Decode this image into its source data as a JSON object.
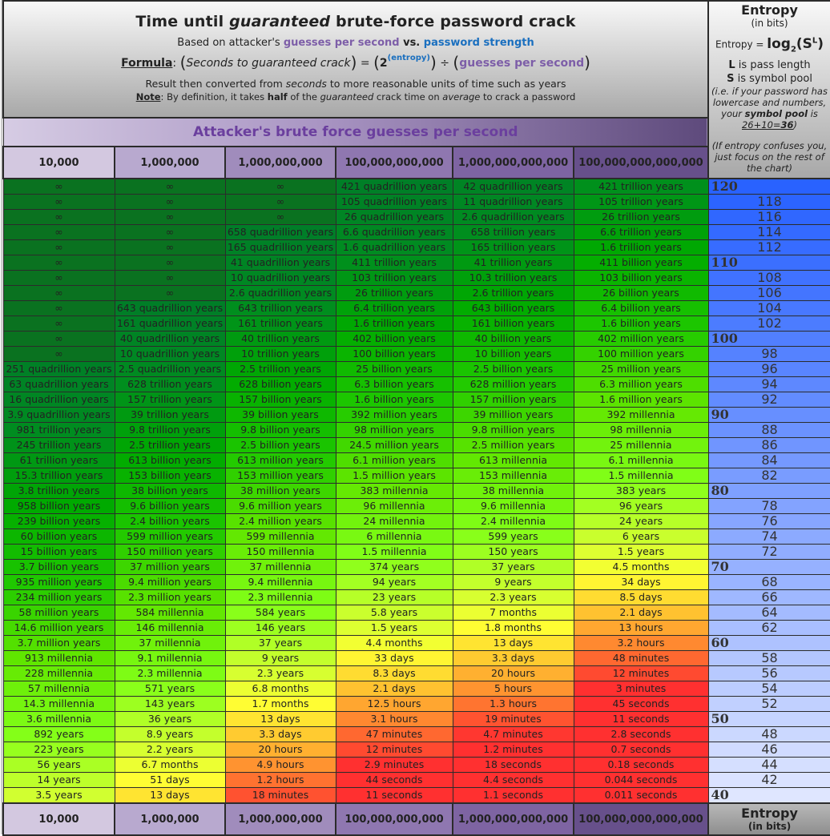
{
  "header": {
    "title_pre": "Time until ",
    "title_em": "guaranteed",
    "title_post": " brute-force password crack",
    "subtitle_pre": "Based on attacker's ",
    "subtitle_gps": "guesses per second",
    "subtitle_vs": " vs. ",
    "subtitle_strength": "password strength",
    "formula_label": "Formula",
    "formula_left": "Seconds to guaranteed crack",
    "formula_eq": "=",
    "formula_base": "2",
    "formula_exp": "(entropy)",
    "formula_div": "÷",
    "formula_right": "guesses per second",
    "result_pre": "Result then converted from ",
    "result_em": "seconds",
    "result_post": " to more reasonable units of time such as years",
    "note_label": "Note",
    "note_a": ": By definition, it takes ",
    "note_half": "half",
    "note_b": " of the ",
    "note_em": "guaranteed",
    "note_c": " crack time on ",
    "note_avg": "average",
    "note_d": " to crack a password"
  },
  "entropy_panel": {
    "title": "Entropy",
    "unit": "(in bits)",
    "formula_pre": "Entropy = ",
    "formula_log": "log",
    "formula_sub": "2",
    "formula_s": "(S",
    "formula_sup": "L",
    "formula_close": ")",
    "l_key": "L",
    "l_desc": " is pass length",
    "s_key": "S",
    "s_desc": " is symbol pool",
    "note_1": "(i.e. if your password has lowercase and numbers, your ",
    "note_symbol": "symbol pool",
    "note_is": " is ",
    "note_sum": "26+10=",
    "note_36": "36",
    "note_close": ")",
    "note_2": "(If entropy confuses you, just focus on the rest of the chart)"
  },
  "banner": {
    "pre": "Attacker's brute force ",
    "bold": "guesses per second"
  },
  "footer": {
    "entropy_title": "Entropy",
    "entropy_unit": "(in bits)"
  },
  "colors": {
    "entropy_blue_strong": "#2962ff",
    "entropy_blue_light": "#dfe6ff",
    "infinity_green": "#0a7220",
    "red": "#ff3030",
    "yellow": "#ffff33"
  },
  "chart_data": {
    "type": "table",
    "title": "Time until guaranteed brute-force password crack",
    "xlabel": "Attacker's brute force guesses per second",
    "ylabel": "Entropy (in bits)",
    "columns": [
      "10,000",
      "1,000,000",
      "1,000,000,000",
      "100,000,000,000",
      "1,000,000,000,000",
      "100,000,000,000,000"
    ],
    "guesses_per_second": [
      10000,
      1000000,
      1000000000,
      100000000000,
      1000000000000,
      100000000000000
    ],
    "rows": [
      {
        "entropy": 120,
        "major": true,
        "cells": [
          "∞",
          "∞",
          "∞",
          "421 quadrillion years",
          "42 quadrillion years",
          "421 trillion years"
        ]
      },
      {
        "entropy": 118,
        "major": false,
        "cells": [
          "∞",
          "∞",
          "∞",
          "105 quadrillion years",
          "11 quadrillion years",
          "105 trillion years"
        ]
      },
      {
        "entropy": 116,
        "major": false,
        "cells": [
          "∞",
          "∞",
          "∞",
          "26 quadrillion years",
          "2.6 quadrillion years",
          "26 trillion years"
        ]
      },
      {
        "entropy": 114,
        "major": false,
        "cells": [
          "∞",
          "∞",
          "658 quadrillion years",
          "6.6 quadrillion years",
          "658 trillion years",
          "6.6 trillion years"
        ]
      },
      {
        "entropy": 112,
        "major": false,
        "cells": [
          "∞",
          "∞",
          "165 quadrillion years",
          "1.6 quadrillion years",
          "165 trillion years",
          "1.6 trillion years"
        ]
      },
      {
        "entropy": 110,
        "major": true,
        "cells": [
          "∞",
          "∞",
          "41 quadrillion years",
          "411 trillion years",
          "41 trillion years",
          "411 billion years"
        ]
      },
      {
        "entropy": 108,
        "major": false,
        "cells": [
          "∞",
          "∞",
          "10 quadrillion years",
          "103 trillion years",
          "10.3 trillion years",
          "103 billion years"
        ]
      },
      {
        "entropy": 106,
        "major": false,
        "cells": [
          "∞",
          "∞",
          "2.6 quadrillion years",
          "26 trillion years",
          "2.6 trillion years",
          "26 billion years"
        ]
      },
      {
        "entropy": 104,
        "major": false,
        "cells": [
          "∞",
          "643 quadrillion years",
          "643 trillion years",
          "6.4 trillion years",
          "643 billion years",
          "6.4 billion years"
        ]
      },
      {
        "entropy": 102,
        "major": false,
        "cells": [
          "∞",
          "161 quadrillion years",
          "161 trillion years",
          "1.6 trillion years",
          "161 billion years",
          "1.6 billion years"
        ]
      },
      {
        "entropy": 100,
        "major": true,
        "cells": [
          "∞",
          "40 quadrillion years",
          "40 trillion years",
          "402 billion years",
          "40 billion years",
          "402 million years"
        ]
      },
      {
        "entropy": 98,
        "major": false,
        "cells": [
          "∞",
          "10 quadrillion years",
          "10 trillion years",
          "100 billion years",
          "10 billion years",
          "100 million years"
        ]
      },
      {
        "entropy": 96,
        "major": false,
        "cells": [
          "251 quadrillion years",
          "2.5 quadrillion years",
          "2.5 trillion years",
          "25 billion years",
          "2.5 billion years",
          "25 million years"
        ]
      },
      {
        "entropy": 94,
        "major": false,
        "cells": [
          "63 quadrillion years",
          "628 trillion years",
          "628 billion years",
          "6.3 billion years",
          "628 million years",
          "6.3 million years"
        ]
      },
      {
        "entropy": 92,
        "major": false,
        "cells": [
          "16 quadrillion years",
          "157 trillion years",
          "157 billion years",
          "1.6 billion years",
          "157 million years",
          "1.6 million years"
        ]
      },
      {
        "entropy": 90,
        "major": true,
        "cells": [
          "3.9 quadrillion years",
          "39 trillion years",
          "39 billion years",
          "392 million years",
          "39 million years",
          "392 millennia"
        ]
      },
      {
        "entropy": 88,
        "major": false,
        "cells": [
          "981 trillion years",
          "9.8 trillion years",
          "9.8 billion years",
          "98 million years",
          "9.8 million years",
          "98 millennia"
        ]
      },
      {
        "entropy": 86,
        "major": false,
        "cells": [
          "245 trillion years",
          "2.5 trillion years",
          "2.5 billion years",
          "24.5 million years",
          "2.5 million years",
          "25 millennia"
        ]
      },
      {
        "entropy": 84,
        "major": false,
        "cells": [
          "61 trillion years",
          "613 billion years",
          "613 million years",
          "6.1 million years",
          "613 millennia",
          "6.1 millennia"
        ]
      },
      {
        "entropy": 82,
        "major": false,
        "cells": [
          "15.3 trillion years",
          "153 billion years",
          "153 million years",
          "1.5 million years",
          "153 millennia",
          "1.5 millennia"
        ]
      },
      {
        "entropy": 80,
        "major": true,
        "cells": [
          "3.8 trillion years",
          "38 billion years",
          "38 million years",
          "383 millennia",
          "38 millennia",
          "383 years"
        ]
      },
      {
        "entropy": 78,
        "major": false,
        "cells": [
          "958 billion years",
          "9.6 billion years",
          "9.6 million years",
          "96 millennia",
          "9.6 millennia",
          "96 years"
        ]
      },
      {
        "entropy": 76,
        "major": false,
        "cells": [
          "239 billion years",
          "2.4 billion years",
          "2.4 million years",
          "24 millennia",
          "2.4 millennia",
          "24 years"
        ]
      },
      {
        "entropy": 74,
        "major": false,
        "cells": [
          "60 billion years",
          "599 million years",
          "599 millennia",
          "6 millennia",
          "599 years",
          "6 years"
        ]
      },
      {
        "entropy": 72,
        "major": false,
        "cells": [
          "15 billion years",
          "150 million years",
          "150 millennia",
          "1.5 millennia",
          "150 years",
          "1.5 years"
        ]
      },
      {
        "entropy": 70,
        "major": true,
        "cells": [
          "3.7 billion years",
          "37 million years",
          "37 millennia",
          "374 years",
          "37 years",
          "4.5 months"
        ]
      },
      {
        "entropy": 68,
        "major": false,
        "cells": [
          "935 million years",
          "9.4 million years",
          "9.4 millennia",
          "94 years",
          "9 years",
          "34 days"
        ]
      },
      {
        "entropy": 66,
        "major": false,
        "cells": [
          "234 million years",
          "2.3 million years",
          "2.3 millennia",
          "23 years",
          "2.3 years",
          "8.5 days"
        ]
      },
      {
        "entropy": 64,
        "major": false,
        "cells": [
          "58 million years",
          "584 millennia",
          "584 years",
          "5.8 years",
          "7 months",
          "2.1 days"
        ]
      },
      {
        "entropy": 62,
        "major": false,
        "cells": [
          "14.6 million years",
          "146 millennia",
          "146 years",
          "1.5 years",
          "1.8 months",
          "13 hours"
        ]
      },
      {
        "entropy": 60,
        "major": true,
        "cells": [
          "3.7 million years",
          "37 millennia",
          "37 years",
          "4.4 months",
          "13 days",
          "3.2 hours"
        ]
      },
      {
        "entropy": 58,
        "major": false,
        "cells": [
          "913 millennia",
          "9.1 millennia",
          "9 years",
          "33 days",
          "3.3 days",
          "48 minutes"
        ]
      },
      {
        "entropy": 56,
        "major": false,
        "cells": [
          "228 millennia",
          "2.3 millennia",
          "2.3 years",
          "8.3 days",
          "20 hours",
          "12 minutes"
        ]
      },
      {
        "entropy": 54,
        "major": false,
        "cells": [
          "57 millennia",
          "571 years",
          "6.8 months",
          "2.1 days",
          "5 hours",
          "3 minutes"
        ]
      },
      {
        "entropy": 52,
        "major": false,
        "cells": [
          "14.3 millennia",
          "143 years",
          "1.7 months",
          "12.5 hours",
          "1.3 hours",
          "45 seconds"
        ]
      },
      {
        "entropy": 50,
        "major": true,
        "cells": [
          "3.6 millennia",
          "36 years",
          "13 days",
          "3.1 hours",
          "19 minutes",
          "11 seconds"
        ]
      },
      {
        "entropy": 48,
        "major": false,
        "cells": [
          "892 years",
          "8.9 years",
          "3.3 days",
          "47 minutes",
          "4.7 minutes",
          "2.8 seconds"
        ]
      },
      {
        "entropy": 46,
        "major": false,
        "cells": [
          "223 years",
          "2.2 years",
          "20 hours",
          "12 minutes",
          "1.2 minutes",
          "0.7 seconds"
        ]
      },
      {
        "entropy": 44,
        "major": false,
        "cells": [
          "56 years",
          "6.7 months",
          "4.9 hours",
          "2.9 minutes",
          "18 seconds",
          "0.18 seconds"
        ]
      },
      {
        "entropy": 42,
        "major": false,
        "cells": [
          "14 years",
          "51 days",
          "1.2 hours",
          "44 seconds",
          "4.4 seconds",
          "0.044 seconds"
        ]
      },
      {
        "entropy": 40,
        "major": true,
        "cells": [
          "3.5 years",
          "13 days",
          "18 minutes",
          "11 seconds",
          "1.1 seconds",
          "0.011 seconds"
        ]
      }
    ]
  }
}
